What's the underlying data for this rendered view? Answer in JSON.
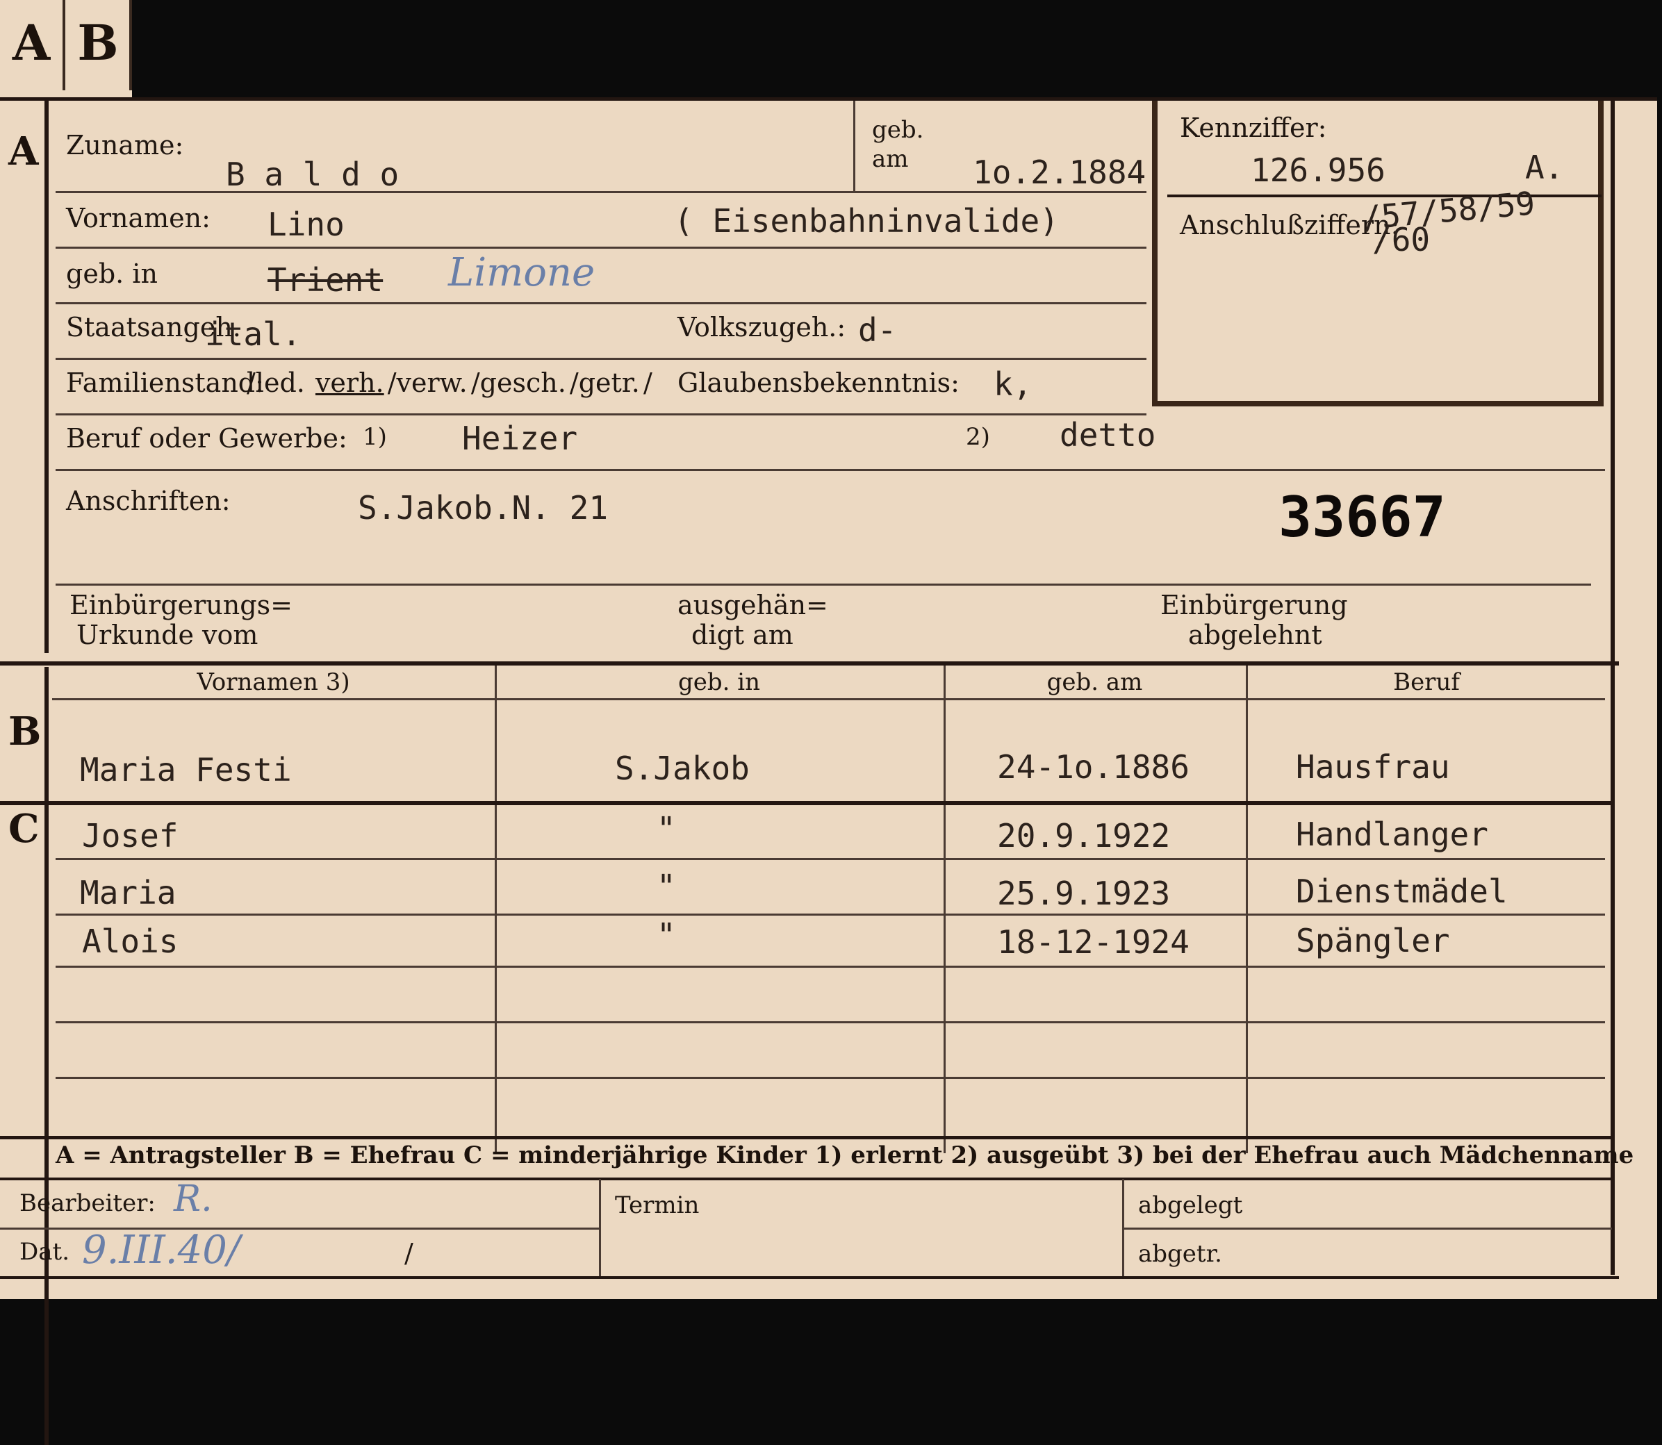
{
  "tabs": [
    "A",
    "B"
  ],
  "sections": {
    "a": "A",
    "b": "B",
    "c": "C"
  },
  "section_a": {
    "zuname_label": "Zuname:",
    "zuname": "B a l d o",
    "geb_am_label_1": "geb.",
    "geb_am_label_2": "am",
    "geb_am": "1o.2.1884",
    "vornamen_label": "Vornamen:",
    "vornamen": "Lino",
    "vornamen_note": "( Eisenbahninvalide)",
    "geb_in_label": "geb. in",
    "geb_in_struck": "Trient",
    "geb_in_hand": "Limone",
    "staatsangeh_label": "Staatsangeh.",
    "staatsangeh": "ital.",
    "volkszugeh_label": "Volkszugeh.:",
    "volkszugeh": "d-",
    "familienstand_label": "Familienstand:",
    "familienstand_opts": [
      "/led.",
      "verh.",
      "/verw.",
      "/gesch.",
      "/getr.",
      "/"
    ],
    "glaubens_label": "Glaubensbekenntnis:",
    "glaubens": "k,",
    "beruf_label": "Beruf oder Gewerbe:",
    "beruf_1_marker": "1)",
    "beruf_1": "Heizer",
    "beruf_2_marker": "2)",
    "beruf_2": "detto",
    "anschriften_label": "Anschriften:",
    "anschriften": "S.Jakob.N. 21",
    "stamp_number": "33667",
    "einb_urkunde_1": "Einbürgerungs=",
    "einb_urkunde_2": "Urkunde vom",
    "ausgehaendigt_1": "ausgehän=",
    "ausgehaendigt_2": "digt am",
    "einb_abgelehnt_1": "Einbürgerung",
    "einb_abgelehnt_2": "abgelehnt"
  },
  "kennziffer": {
    "label": "Kennziffer:",
    "value": "126.956",
    "suffix": "A.",
    "anschluss_label": "Anschlußziffern:",
    "anschluss_1": "/57/58/59",
    "anschluss_2": "/60"
  },
  "section_b": {
    "headers": [
      "Vornamen 3)",
      "geb. in",
      "geb. am",
      "Beruf"
    ],
    "row": {
      "vornamen": "Maria Festi",
      "geb_in": "S.Jakob",
      "geb_am": "24-1o.1886",
      "beruf": "Hausfrau"
    }
  },
  "section_c": {
    "rows": [
      {
        "vornamen": "Josef",
        "geb_in": "\"",
        "geb_am": "20.9.1922",
        "beruf": "Handlanger"
      },
      {
        "vornamen": "Maria",
        "geb_in": "\"",
        "geb_am": "25.9.1923",
        "beruf": "Dienstmädel"
      },
      {
        "vornamen": "Alois",
        "geb_in": "\"",
        "geb_am": "18-12-1924",
        "beruf": "Spängler"
      }
    ]
  },
  "legend": "A = Antragsteller   B = Ehefrau   C = minderjährige Kinder   1) erlernt   2) ausgeübt   3) bei der Ehefrau auch Mädchenname",
  "footer": {
    "bearbeiter_label": "Bearbeiter:",
    "bearbeiter": "R.",
    "dat_label": "Dat.",
    "dat": "9.III.40/",
    "dat_slash": "/",
    "termin_label": "Termin",
    "abgelegt_label": "abgelegt",
    "abgetr_label": "abgetr."
  },
  "colors": {
    "paper": "#ecd9c2",
    "ink": "#1f1610",
    "typewriter": "#2c221c",
    "pencil": "#6a7fa8",
    "background": "#0b0b0b"
  }
}
